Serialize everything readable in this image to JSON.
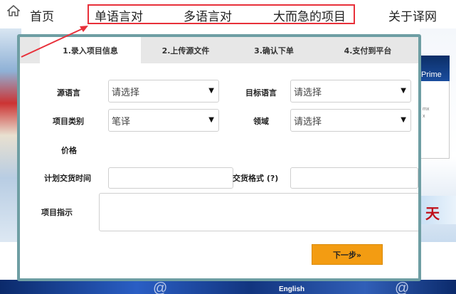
{
  "nav": {
    "home_icon": "home-icon",
    "items": [
      {
        "label": "首页"
      },
      {
        "label": "单语言对"
      },
      {
        "label": "多语言对"
      },
      {
        "label": "大而急的项目"
      },
      {
        "label": "关于译网"
      }
    ],
    "highlight_color": "#e8303a"
  },
  "background": {
    "ad_brand": "Prime",
    "ad_lines": [
      "mx",
      "x"
    ],
    "banner_text": "天",
    "bottom_english": "English"
  },
  "modal": {
    "border_color": "#6e9ea3",
    "steps": [
      {
        "label": "1.录入项目信息",
        "active": true
      },
      {
        "label": "2.上传源文件",
        "active": false
      },
      {
        "label": "3.确认下单",
        "active": false
      },
      {
        "label": "4.支付到平台",
        "active": false
      }
    ],
    "form": {
      "source_language_label": "源语言",
      "source_language_value": "请选择",
      "target_language_label": "目标语言",
      "target_language_value": "请选择",
      "project_type_label": "项目类别",
      "project_type_value": "笔译",
      "domain_label": "领域",
      "domain_value": "请选择",
      "price_label": "价格",
      "delivery_time_label": "计划交货时间",
      "delivery_time_value": "",
      "delivery_format_label": "交货格式 (?)",
      "delivery_format_value": "",
      "instructions_label": "项目指示",
      "instructions_value": ""
    },
    "next_button_label": "下一步»",
    "next_button_color": "#f39c12"
  }
}
